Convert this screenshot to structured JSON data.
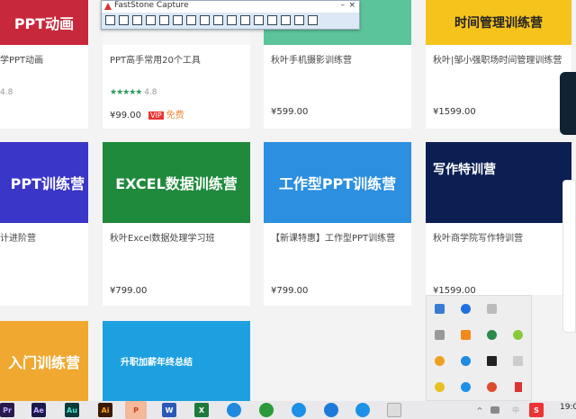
{
  "faststone": {
    "title": "FastStone Capture",
    "minimize": "–",
    "close": "×"
  },
  "cards": [
    {
      "banner": "PPT动画",
      "title": "学PPT动画",
      "rating": "4.8",
      "price": "",
      "color": "#c8283c"
    },
    {
      "banner": "",
      "title": "PPT高手常用20个工具",
      "rating": "4.8",
      "price": "¥99.00",
      "vip": "VIP",
      "free": "免费",
      "color": "#f6f6f6"
    },
    {
      "banner": "",
      "title": "秋叶手机摄影训练营",
      "price": "¥599.00",
      "color": "#5cc49a"
    },
    {
      "banner": "时间管理训练营",
      "title": "秋叶|邹小强职场时间管理训练营",
      "price": "¥1599.00",
      "color": "#f5c31c"
    },
    {
      "banner": "PPT训练营",
      "title": "计进阶营",
      "price": "",
      "color": "#3a36c8"
    },
    {
      "banner": "EXCEL数据训练营",
      "title": "秋叶Excel数据处理学习班",
      "price": "¥799.00",
      "color": "#1f8a3c"
    },
    {
      "banner": "工作型PPT训练营",
      "title": "【新课特惠】工作型PPT训练营",
      "price": "¥799.00",
      "color": "#2c8fe0"
    },
    {
      "banner": "写作特训营",
      "title": "秋叶商学院写作特训营",
      "price": "¥1599.00",
      "color": "#0c1f52"
    },
    {
      "banner": "入门训练营",
      "color": "#f0a830"
    },
    {
      "banner": "升职加薪年终总结",
      "color": "#1ea0e0"
    }
  ],
  "taskbar": {
    "apps": [
      "Pr",
      "Ae",
      "Au",
      "Ai",
      "P",
      "W",
      "X"
    ],
    "time": "19:0"
  }
}
